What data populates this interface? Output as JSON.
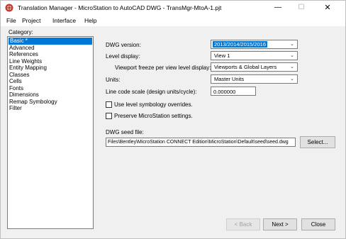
{
  "window": {
    "title": "Translation Manager - MicroStation to AutoCAD DWG - TransMgr-MtoA-1.pjt",
    "min_glyph": "—",
    "max_glyph": "☐",
    "close_glyph": "✕"
  },
  "menu": {
    "file": "File",
    "project": "Project",
    "interface": "Interface",
    "help": "Help"
  },
  "category": {
    "label": "Category:",
    "items": [
      {
        "label": "Basic *",
        "selected": true
      },
      {
        "label": "Advanced"
      },
      {
        "label": "References"
      },
      {
        "label": "Line Weights"
      },
      {
        "label": "Entity Mapping"
      },
      {
        "label": "Classes"
      },
      {
        "label": "Cells"
      },
      {
        "label": "Fonts"
      },
      {
        "label": "Dimensions"
      },
      {
        "label": "Remap Symbology"
      },
      {
        "label": "Filter"
      }
    ]
  },
  "form": {
    "dwg_version_label": "DWG version:",
    "dwg_version_value": "2013/2014/2015/2016",
    "level_display_label": "Level display:",
    "level_display_value": "View 1",
    "viewport_freeze_label": "Viewport freeze per view level display:",
    "viewport_freeze_value": "Viewports & Global Layers",
    "units_label": "Units:",
    "units_value": "Master Units",
    "line_code_label": "Line code scale (design units/cycle):",
    "line_code_value": "0.000000",
    "use_level_symbology_label": "Use level symbology overrides.",
    "use_level_symbology_checked": false,
    "preserve_settings_label": "Preserve MicroStation settings.",
    "preserve_settings_checked": false,
    "seed_file_label": "DWG seed file:",
    "seed_file_value": "Files\\Bentley\\MicroStation CONNECT Edition\\MicroStation\\Default\\seed\\seed.dwg",
    "select_button": "Select..."
  },
  "buttons": {
    "back": "< Back",
    "next": "Next >",
    "close": "Close"
  },
  "colors": {
    "accent": "#0078d7",
    "icon_red": "#c0392b"
  },
  "icons": {
    "app": "translation-manager-icon",
    "dropdown": "chevron-down-icon"
  }
}
